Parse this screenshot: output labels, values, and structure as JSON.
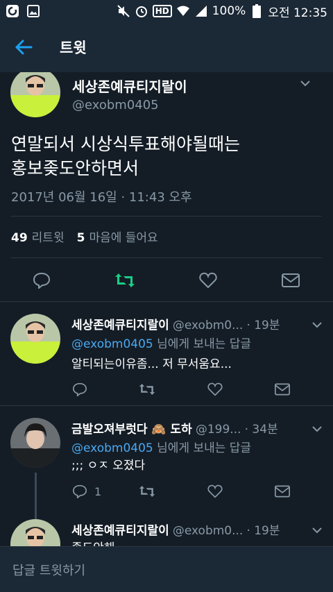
{
  "status_bar": {
    "battery_pct": "100%",
    "network": "HD",
    "time": "오전 12:35",
    "icons": [
      "app-icon",
      "gallery-icon",
      "mute-icon",
      "alarm-icon",
      "wifi-icon",
      "signal-icon"
    ]
  },
  "header": {
    "title": "트윗",
    "back_icon": "back-arrow-icon"
  },
  "main_tweet": {
    "name": "세상존예큐티지랄이",
    "handle": "@exobm0405",
    "text_line1": "연말되서 시상식투표해야될때는",
    "text_line2": "홍보좆도안하면서",
    "timestamp": "2017년 06월 16일 · 11:43 오후",
    "retweet_count": "49",
    "retweet_label": "리트윗",
    "like_count": "5",
    "like_label": "마음에 들어요"
  },
  "replies": [
    {
      "name": "세상존예큐티지랄이",
      "handle": "@exobm0...",
      "time": "· 19분",
      "reply_to": "@exobm0405",
      "reply_to_suffix": "님에게 보내는 답글",
      "text": "알티되는이유좀... 저 무서움요...",
      "reply_count": ""
    },
    {
      "name": "금발오져부럿다 🙈 도하",
      "handle": "@199...",
      "time": "· 34분",
      "reply_to": "@exobm0405",
      "reply_to_suffix": "님에게 보내는 답글",
      "text": ";;; ㅇㅈ 오졌다",
      "reply_count": "1"
    },
    {
      "name": "세상존예큐티지랄이",
      "handle": "@exobm0...",
      "time": "· 19분",
      "text": "좆도안해~~~"
    }
  ],
  "composer": {
    "placeholder": "답글 트윗하기"
  },
  "colors": {
    "background": "#141d26",
    "bar": "#1b2836",
    "accent": "#1da1f2",
    "retweet_green": "#19cf86",
    "muted": "#8899a6"
  }
}
